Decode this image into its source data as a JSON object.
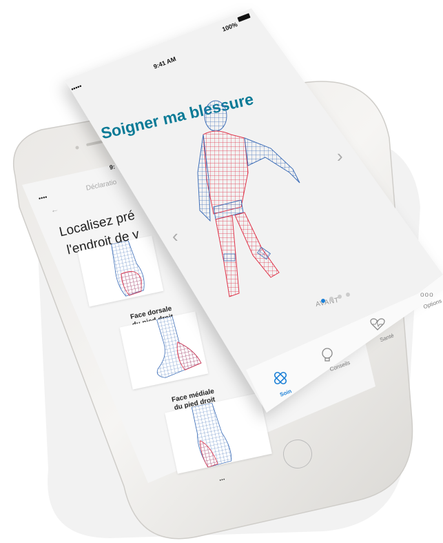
{
  "back_screen": {
    "status_time": "9:",
    "signal": "••••",
    "nav_title": "Déclaratio",
    "back_arrow": "←",
    "heading_line1": "Localisez pré",
    "heading_line2": "l'endroit de v",
    "foot_items": [
      {
        "label": "Face dorsale\ndu pied droit"
      },
      {
        "label": "Face médiale\ndu pied droit"
      },
      {
        "label": "..."
      }
    ]
  },
  "front_screen": {
    "status_signal": "•••••",
    "status_time": "9:41 AM",
    "status_battery": "100%",
    "title": "Soigner ma blessure",
    "view_label": "AVANT",
    "prev_arrow": "‹",
    "next_arrow": "›",
    "page_dots": {
      "count": 4,
      "active": 0
    },
    "tabs": [
      {
        "label": "Soin",
        "icon": "bandage-icon",
        "active": true
      },
      {
        "label": "Conseils",
        "icon": "lightbulb-icon",
        "active": false
      },
      {
        "label": "Santé",
        "icon": "heart-pulse-icon",
        "active": false
      },
      {
        "label": "Options",
        "icon": "more-icon",
        "active": false
      }
    ]
  },
  "colors": {
    "title": "#0a7a96",
    "mesh_blue": "#3f6fb8",
    "mesh_red": "#e0344a",
    "tab_active": "#1a7fd6",
    "dot_active": "#1a7fd6"
  }
}
